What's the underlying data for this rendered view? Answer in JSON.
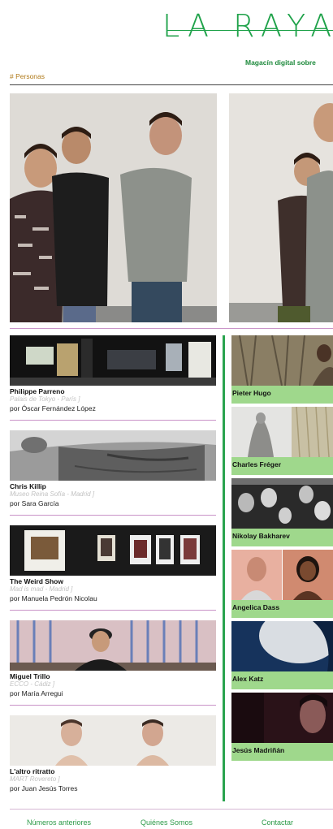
{
  "site": {
    "logo": "LA RAYA",
    "tagline": "Magacín digital sobre"
  },
  "section_tag": "# Personas",
  "left_cards": [
    {
      "name": "Philippe Parreno",
      "venue": "Palais de Tokyo - París ]",
      "author": "por Óscar Fernández López"
    },
    {
      "name": "Chris Killip",
      "venue": "Museo Reina Sofía - Madrid ]",
      "author": "por Sara García"
    },
    {
      "name": "The Weird Show",
      "venue": "Mad is mad - Madrid ]",
      "author": "por Manuela Pedrón Nicolau"
    },
    {
      "name": "Miguel Trillo",
      "venue": "ECCO - Cádiz ]",
      "author": "por María Arregui"
    },
    {
      "name": "L'altro ritratto",
      "venue": "MART Rovereto ]",
      "author": "por Juan Jesús Torres"
    }
  ],
  "right_cards": [
    {
      "name": "Pieter Hugo"
    },
    {
      "name": "Charles Fréger"
    },
    {
      "name": "Nikolay Bakharev"
    },
    {
      "name": "Angelica Dass"
    },
    {
      "name": "Alex Katz"
    },
    {
      "name": "Jesús Madriñán"
    }
  ],
  "footer": {
    "previous": "Números anteriores",
    "about": "Quiénes Somos",
    "contact": "Contactar"
  },
  "colors": {
    "brand_green": "#1fa24a",
    "label_green": "#9fd88c",
    "tag_orange": "#b07a1a",
    "separator_pink": "#c993c8"
  }
}
